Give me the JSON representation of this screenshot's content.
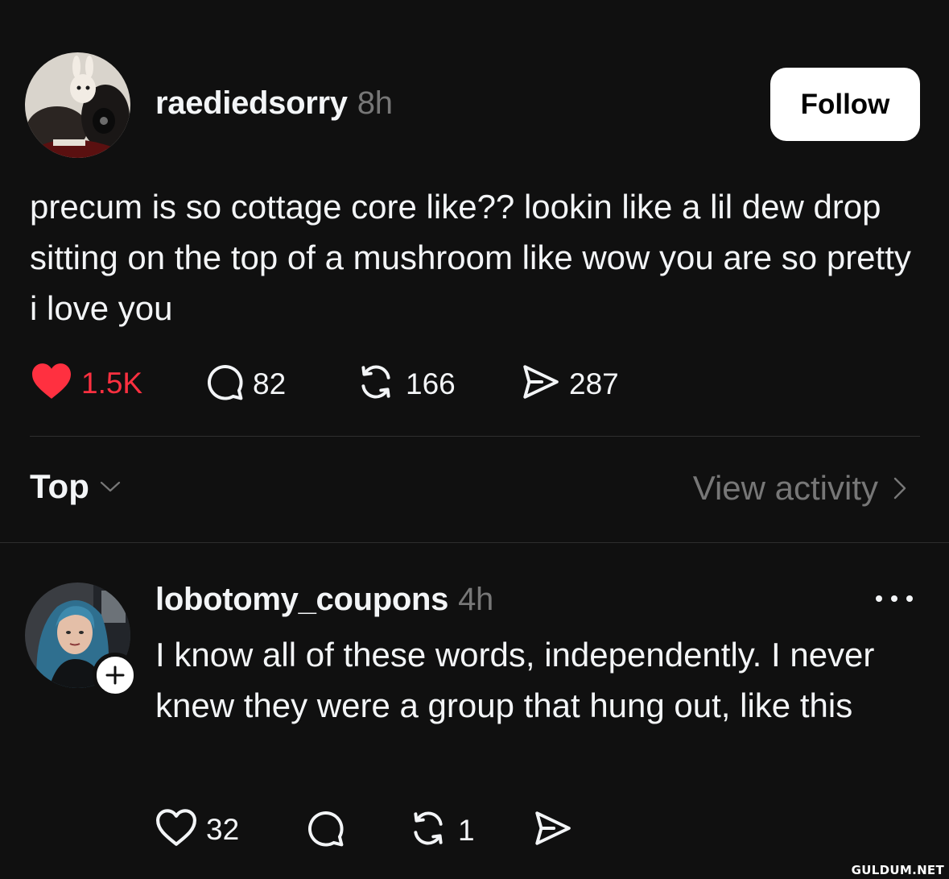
{
  "post": {
    "username": "raediedsorry",
    "time": "8h",
    "follow_label": "Follow",
    "text": "precum is so cottage core like?? lookin like a lil dew drop sitting on the top of a mushroom like wow you are so pretty i love you",
    "actions": {
      "likes": "1.5K",
      "liked": true,
      "comments": "82",
      "reposts": "166",
      "shares": "287"
    }
  },
  "thread_bar": {
    "sort_label": "Top",
    "view_activity_label": "View activity"
  },
  "reply": {
    "username": "lobotomy_coupons",
    "time": "4h",
    "text": "I know all of these words, independently. I never knew they were a group that hung out, like this",
    "actions": {
      "likes": "32",
      "reposts": "1"
    }
  },
  "watermark": "GULDUM.NET",
  "colors": {
    "background": "#101010",
    "primary_text": "#f3f5f7",
    "secondary_text": "#777777",
    "like_red": "#ff3040",
    "divider": "#2e2e2e"
  },
  "icons": {
    "like_filled": "heart-filled-icon",
    "like": "heart-icon",
    "comment": "speech-bubble-icon",
    "repost": "repost-arrows-icon",
    "share": "paper-plane-icon",
    "sort": "chevron-down-icon",
    "view_activity": "chevron-right-icon",
    "more": "ellipsis-icon",
    "follow_badge": "plus-icon"
  }
}
